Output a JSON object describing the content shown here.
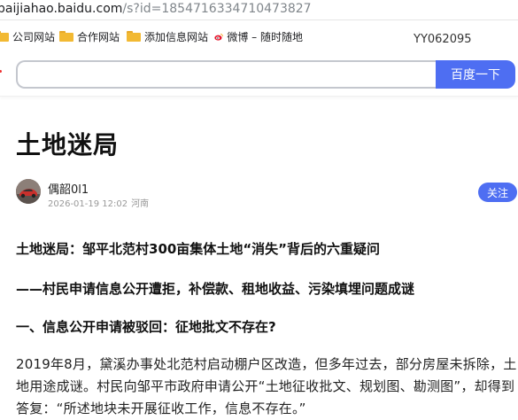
{
  "browser": {
    "url_host": "baijiahao.baidu.com",
    "url_path": "/s?id=1854716334710473827",
    "bookmarks": [
      {
        "label": "公司网站",
        "icon": "folder-icon"
      },
      {
        "label": "合作网站",
        "icon": "folder-icon"
      },
      {
        "label": "添加信息网站",
        "icon": "folder-icon"
      },
      {
        "label": "微博 – 随时随地",
        "icon": "weibo-icon"
      }
    ],
    "side_text": "YY062095"
  },
  "search": {
    "input_value": "",
    "button_label": "百度一下",
    "accent": "#4e6ef2"
  },
  "article": {
    "title": "土地迷局",
    "author": "偶韶0l1",
    "date": "2026-01-19 12:02",
    "location": "河南",
    "follow_label": "关注",
    "heading1": "土地迷局：邹平北范村300亩集体土地“消失”背后的六重疑问",
    "heading2": "——村民申请信息公开遭拒，补偿款、租地收益、污染填埋问题成谜",
    "heading3": "一、信息公开申请被驳回：征地批文不存在?",
    "paragraph1": "2019年8月，黛溪办事处北范村启动棚户区改造，但多年过去，部分房屋未拆除，土地用途成谜。村民向邹平市政府申请公开“土地征收批文、规划图、勘测图”，却得到答复：“所述地块未开展征收工作，信息不存在。”"
  }
}
